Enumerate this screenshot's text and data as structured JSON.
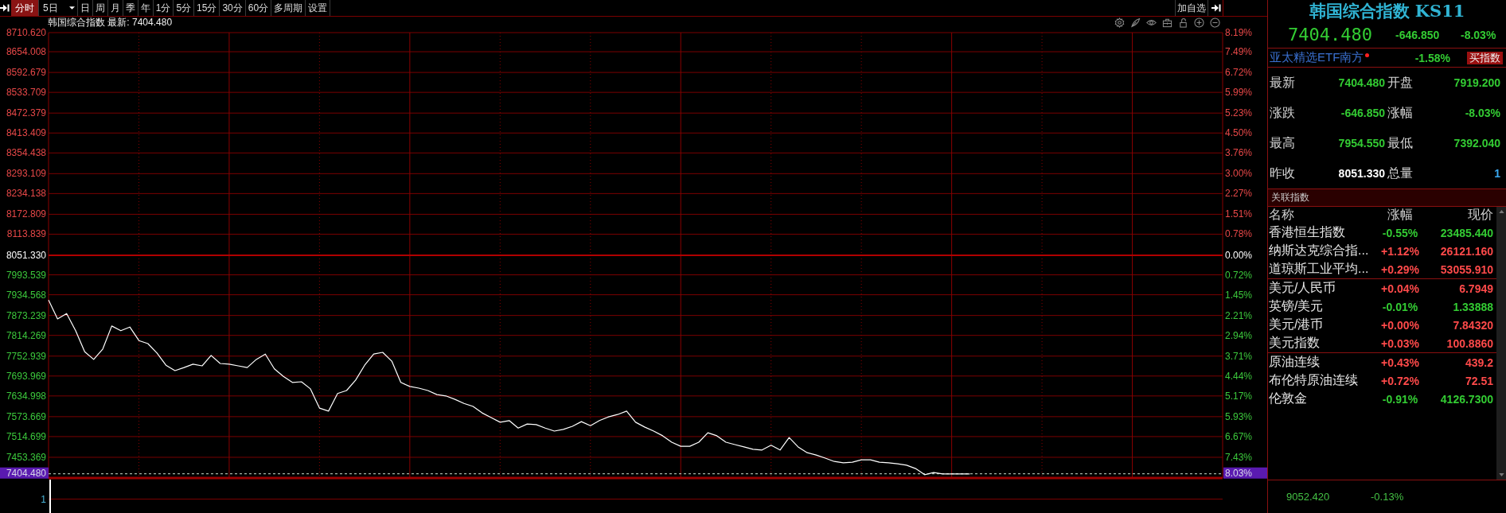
{
  "toolbar": {
    "items": [
      {
        "label": "分时",
        "kind": "button",
        "selected": true
      },
      {
        "label": "5日",
        "kind": "dropdown",
        "selected": false
      },
      {
        "label": "日",
        "kind": "button",
        "selected": false
      },
      {
        "label": "周",
        "kind": "button",
        "selected": false
      },
      {
        "label": "月",
        "kind": "button",
        "selected": false
      },
      {
        "label": "季",
        "kind": "button",
        "selected": false
      },
      {
        "label": "年",
        "kind": "button",
        "selected": false
      },
      {
        "label": "1分",
        "kind": "button",
        "selected": false
      },
      {
        "label": "5分",
        "kind": "button",
        "selected": false
      },
      {
        "label": "15分",
        "kind": "button",
        "selected": false
      },
      {
        "label": "30分",
        "kind": "button",
        "selected": false
      },
      {
        "label": "60分",
        "kind": "button",
        "selected": false
      },
      {
        "label": "多周期",
        "kind": "button",
        "selected": false
      },
      {
        "label": "设置",
        "kind": "button",
        "selected": false
      }
    ],
    "watchlist_button": "加自选"
  },
  "chart": {
    "chart_data": {
      "type": "line",
      "title": "韩国综合指数 最新: 7404.480",
      "grid": true,
      "ylim": [
        7392.04,
        8710.62
      ],
      "yticks": [
        {
          "value": 8710.62,
          "label": "8710.620"
        },
        {
          "value": 8654.008,
          "label": "8654.008"
        },
        {
          "value": 8592.679,
          "label": "8592.679"
        },
        {
          "value": 8533.709,
          "label": "8533.709"
        },
        {
          "value": 8472.379,
          "label": "8472.379"
        },
        {
          "value": 8413.409,
          "label": "8413.409"
        },
        {
          "value": 8354.438,
          "label": "8354.438"
        },
        {
          "value": 8293.109,
          "label": "8293.109"
        },
        {
          "value": 8234.138,
          "label": "8234.138"
        },
        {
          "value": 8172.809,
          "label": "8172.809"
        },
        {
          "value": 8113.839,
          "label": "8113.839"
        },
        {
          "value": 8051.33,
          "label": "8051.330"
        },
        {
          "value": 7993.539,
          "label": "7993.539"
        },
        {
          "value": 7934.568,
          "label": "7934.568"
        },
        {
          "value": 7873.239,
          "label": "7873.239"
        },
        {
          "value": 7814.269,
          "label": "7814.269"
        },
        {
          "value": 7752.939,
          "label": "7752.939"
        },
        {
          "value": 7693.969,
          "label": "7693.969"
        },
        {
          "value": 7634.998,
          "label": "7634.998"
        },
        {
          "value": 7573.669,
          "label": "7573.669"
        },
        {
          "value": 7514.699,
          "label": "7514.699"
        },
        {
          "value": 7453.369,
          "label": "7453.369"
        }
      ],
      "series": [
        {
          "color": "#ffffff",
          "values": [
            7919,
            7863,
            7879,
            7828,
            7766,
            7743,
            7774,
            7842,
            7828,
            7839,
            7799,
            7790,
            7762,
            7726,
            7710,
            7719,
            7729,
            7724,
            7755,
            7731,
            7729,
            7724,
            7719,
            7743,
            7759,
            7715,
            7693,
            7675,
            7677,
            7656,
            7599,
            7590,
            7642,
            7651,
            7682,
            7726,
            7759,
            7764,
            7738,
            7675,
            7663,
            7658,
            7651,
            7639,
            7635,
            7625,
            7613,
            7604,
            7585,
            7571,
            7557,
            7562,
            7540,
            7552,
            7550,
            7540,
            7531,
            7536,
            7545,
            7559,
            7547,
            7562,
            7573,
            7580,
            7590,
            7557,
            7543,
            7531,
            7517,
            7498,
            7486,
            7486,
            7498,
            7526,
            7517,
            7498,
            7491,
            7484,
            7477,
            7475,
            7489,
            7475,
            7512,
            7484,
            7467,
            7460,
            7451,
            7441,
            7437,
            7439,
            7446,
            7446,
            7439,
            7437,
            7434,
            7430,
            7420,
            7402,
            7408,
            7404,
            7404,
            7404,
            7404,
            null,
            null,
            null,
            null,
            null,
            null,
            null,
            null,
            null,
            null,
            null,
            null,
            null,
            null,
            null,
            null,
            null,
            null,
            null,
            null,
            null,
            null,
            null,
            null,
            null,
            null,
            null,
            null
          ]
        }
      ],
      "ref_lines": [
        {
          "axis": "y",
          "value": 8051.33,
          "color": "#b00000"
        },
        {
          "axis": "y",
          "value": 7404.48,
          "color": "#cfe3cf",
          "label": "7404.480"
        }
      ]
    },
    "percent_axis": {
      "labels": [
        {
          "label": "8.19%",
          "color": "#e84848"
        },
        {
          "label": "7.49%",
          "color": "#e84848"
        },
        {
          "label": "6.72%",
          "color": "#e84848"
        },
        {
          "label": "5.99%",
          "color": "#e84848"
        },
        {
          "label": "5.23%",
          "color": "#e84848"
        },
        {
          "label": "4.50%",
          "color": "#e84848"
        },
        {
          "label": "3.76%",
          "color": "#e84848"
        },
        {
          "label": "3.00%",
          "color": "#e84848"
        },
        {
          "label": "2.27%",
          "color": "#e84848"
        },
        {
          "label": "1.51%",
          "color": "#e84848"
        },
        {
          "label": "0.78%",
          "color": "#e84848"
        },
        {
          "label": "0.00%",
          "color": "#ffffff"
        },
        {
          "label": "0.72%",
          "color": "#3cc83c"
        },
        {
          "label": "1.45%",
          "color": "#3cc83c"
        },
        {
          "label": "2.21%",
          "color": "#3cc83c"
        },
        {
          "label": "2.94%",
          "color": "#3cc83c"
        },
        {
          "label": "3.71%",
          "color": "#3cc83c"
        },
        {
          "label": "4.44%",
          "color": "#3cc83c"
        },
        {
          "label": "5.17%",
          "color": "#3cc83c"
        },
        {
          "label": "5.93%",
          "color": "#3cc83c"
        },
        {
          "label": "6.67%",
          "color": "#3cc83c"
        },
        {
          "label": "7.43%",
          "color": "#3cc83c"
        }
      ],
      "current": "8.03%"
    },
    "volume_axis": {
      "label": "1"
    }
  },
  "quote": {
    "title": "韩国综合指数 KS11",
    "price": "7404.480",
    "change": "-646.850",
    "change_pct": "-8.03%"
  },
  "etf": {
    "name": "亚太精选ETF南方",
    "change": "-1.58%",
    "button": "买指数"
  },
  "stats": [
    {
      "label": "最新",
      "value": "7404.480",
      "color": "#33cc33"
    },
    {
      "label": "开盘",
      "value": "7919.200",
      "color": "#33cc33"
    },
    {
      "label": "涨跌",
      "value": "-646.850",
      "color": "#33cc33"
    },
    {
      "label": "涨幅",
      "value": "-8.03%",
      "color": "#33cc33"
    },
    {
      "label": "最高",
      "value": "7954.550",
      "color": "#33cc33"
    },
    {
      "label": "最低",
      "value": "7392.040",
      "color": "#33cc33"
    },
    {
      "label": "昨收",
      "value": "8051.330",
      "color": "#ffffff"
    },
    {
      "label": "总量",
      "value": "1",
      "color": "#3aa8f0"
    }
  ],
  "related": {
    "title": "关联指数",
    "columns": [
      "名称",
      "涨幅",
      "现价"
    ],
    "groups": [
      {
        "rows": [
          {
            "name": "香港恒生指数",
            "change": "-0.55%",
            "price": "23485.440",
            "color": "#33cc33"
          },
          {
            "name": "纳斯达克综合指...",
            "change": "+1.12%",
            "price": "26121.160",
            "color": "#ff4a4a"
          },
          {
            "name": "道琼斯工业平均...",
            "change": "+0.29%",
            "price": "53055.910",
            "color": "#ff4a4a"
          }
        ]
      },
      {
        "rows": [
          {
            "name": "美元/人民币",
            "change": "+0.04%",
            "price": "6.7949",
            "color": "#ff4a4a"
          },
          {
            "name": "英镑/美元",
            "change": "-0.01%",
            "price": "1.33888",
            "color": "#33cc33"
          },
          {
            "name": "美元/港币",
            "change": "+0.00%",
            "price": "7.84320",
            "color": "#ff4a4a"
          },
          {
            "name": "美元指数",
            "change": "+0.03%",
            "price": "100.8860",
            "color": "#ff4a4a"
          }
        ]
      },
      {
        "rows": [
          {
            "name": "原油连续",
            "change": "+0.43%",
            "price": "439.2",
            "color": "#ff4a4a"
          },
          {
            "name": "布伦特原油连续",
            "change": "+0.72%",
            "price": "72.51",
            "color": "#ff4a4a"
          },
          {
            "name": "伦敦金",
            "change": "-0.91%",
            "price": "4126.7300",
            "color": "#33cc33"
          }
        ]
      }
    ]
  },
  "footer": {
    "value": "9052.420",
    "change": "-0.13%"
  }
}
